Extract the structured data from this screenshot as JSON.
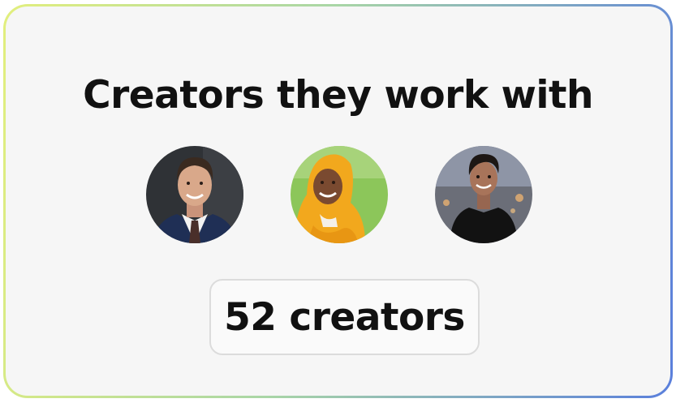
{
  "heading": "Creators they work with",
  "creators": [
    {
      "icon": "creator-avatar-man-suit-icon",
      "colors": {
        "background": "#2f3236",
        "skin": "#d9a88a",
        "hair": "#3a2a20",
        "suit": "#1f2f55",
        "tie": "#4a2f2a"
      }
    },
    {
      "icon": "creator-avatar-woman-yellow-scarf-icon",
      "colors": {
        "background": "#8cc65a",
        "skin": "#7a4a30",
        "scarf": "#f2a81d"
      }
    },
    {
      "icon": "creator-avatar-man-black-jacket-icon",
      "colors": {
        "background": "#6b6e78",
        "skin": "#a8745a",
        "hair": "#1d1714",
        "jacket": "#121212"
      }
    }
  ],
  "count_label": "52 creators",
  "colors": {
    "card_background": "#f6f6f6",
    "border_gradient": [
      "#e2ef7d",
      "#a9d6a6",
      "#5a7fdc"
    ],
    "text": "#111111",
    "count_border": "#dcdcdc"
  }
}
